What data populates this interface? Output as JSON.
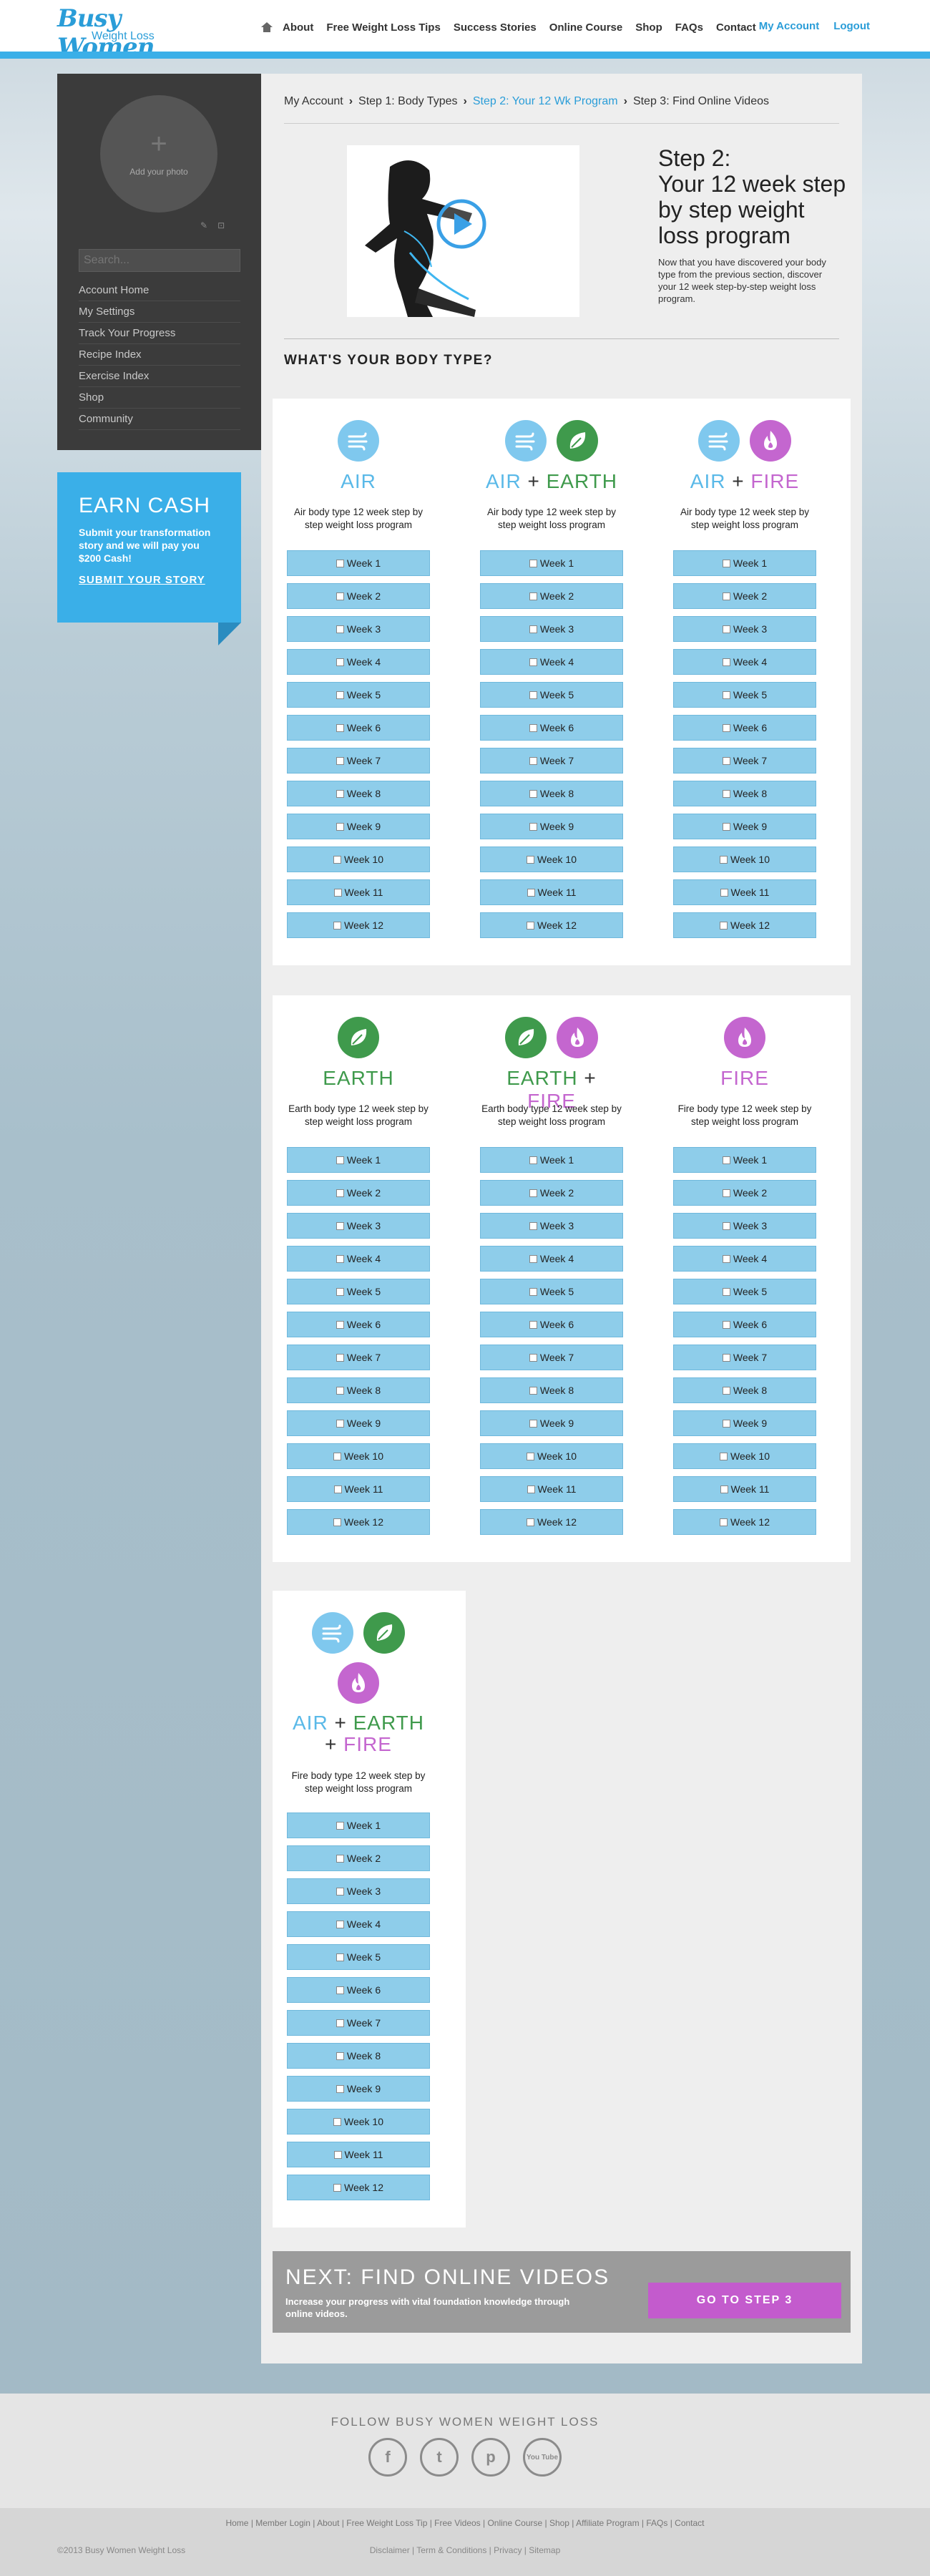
{
  "logo": {
    "main": "Busy Women",
    "sub": "Weight Loss"
  },
  "nav": {
    "items": [
      "About",
      "Free Weight Loss Tips",
      "Success Stories",
      "Online Course",
      "Shop",
      "FAQs",
      "Contact"
    ],
    "account": "My Account",
    "logout": "Logout"
  },
  "sidebar": {
    "photo_label": "Add your photo",
    "search_placeholder": "Search...",
    "menu": [
      "Account Home",
      "My Settings",
      "Track Your Progress",
      "Recipe Index",
      "Exercise Index",
      "Shop",
      "Community"
    ]
  },
  "earn": {
    "title": "EARN CASH",
    "text": "Submit your transformation story and we will pay you $200 Cash!",
    "link": "SUBMIT YOUR STORY"
  },
  "breadcrumb": [
    "My Account",
    "Step 1: Body Types",
    "Step 2: Your 12 Wk Program",
    "Step 3: Find Online Videos"
  ],
  "hero": {
    "title": "Step 2:\nYour 12 week step by step weight loss program",
    "text": "Now that you have discovered your body type from the previous section, discover your 12 week step-by-step weight loss program."
  },
  "section_title": "WHAT'S YOUR BODY TYPE?",
  "plus": "+",
  "type_names": {
    "air": "AIR",
    "earth": "EARTH",
    "fire": "FIRE"
  },
  "descs": {
    "air": "Air body type 12 week step by step weight loss program",
    "earth": "Earth body type 12 week step by step weight loss program",
    "fire": "Fire body type 12 week step by step weight loss program"
  },
  "weeks": [
    "Week 1",
    "Week 2",
    "Week 3",
    "Week 4",
    "Week 5",
    "Week 6",
    "Week 7",
    "Week 8",
    "Week 9",
    "Week 10",
    "Week 11",
    "Week 12"
  ],
  "next": {
    "title": "NEXT: FIND ONLINE VIDEOS",
    "text": "Increase your progress with vital foundation knowledge through online videos.",
    "button": "GO TO STEP 3"
  },
  "footer": {
    "follow": "FOLLOW BUSY WOMEN WEIGHT LOSS",
    "social": [
      "f",
      "t",
      "p",
      "You Tube"
    ],
    "links": "Home | Member Login | About | Free Weight Loss Tip | Free Videos | Online Course | Shop | Affiliate Program | FAQs | Contact",
    "copyright": "©2013 Busy Women Weight Loss",
    "legal": "Disclaimer | Term & Conditions | Privacy | Sitemap"
  }
}
